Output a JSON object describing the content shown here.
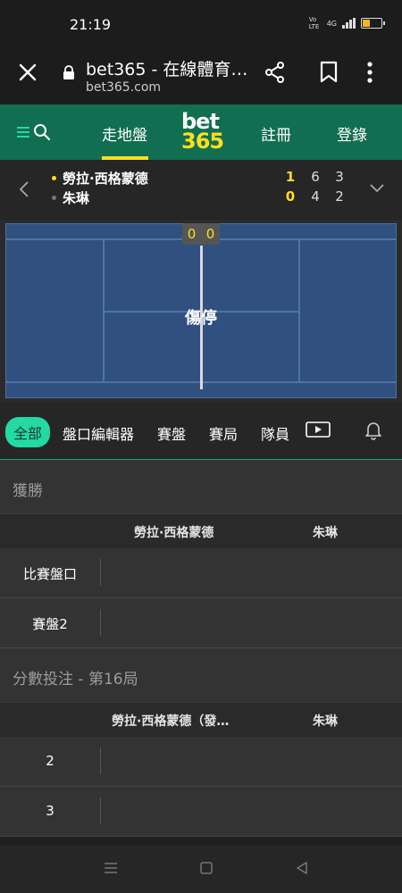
{
  "status_bar": {
    "time": "21:19",
    "signal_text": "4G",
    "volte_text": "Vo LTE"
  },
  "browser": {
    "page_title": "bet365 - 在線體育…",
    "domain": "bet365.com"
  },
  "site_nav": {
    "in_play": "走地盤",
    "logo_top": "bet",
    "logo_bottom": "365",
    "register": "註冊",
    "login": "登錄"
  },
  "scoreboard": {
    "player1": {
      "name": "勞拉·西格蒙德",
      "games": "1",
      "set1": "6",
      "set2": "3",
      "serving": true
    },
    "player2": {
      "name": "朱琳",
      "games": "0",
      "set1": "4",
      "set2": "2",
      "serving": false
    }
  },
  "court": {
    "point_score_p1": "0",
    "point_score_p2": "0",
    "status": "傷停"
  },
  "tabs": {
    "all": "全部",
    "bet_builder": "盤口編輯器",
    "set": "賽盤",
    "game": "賽局",
    "players": "隊員"
  },
  "sections": {
    "winner": {
      "title": "獲勝",
      "col1": "勞拉·西格蒙德",
      "col2": "朱琳",
      "rows": [
        "比賽盤口",
        "賽盤2"
      ]
    },
    "point_betting": {
      "title": "分數投注 - 第16局",
      "col1": "勞拉·西格蒙德（發…",
      "col2": "朱琳",
      "rows": [
        "2",
        "3"
      ]
    }
  },
  "colors": {
    "brand_green": "#126e51",
    "accent_yellow": "#ffdf1b",
    "active_tab": "#24d9a4",
    "court_blue": "#30507f"
  }
}
